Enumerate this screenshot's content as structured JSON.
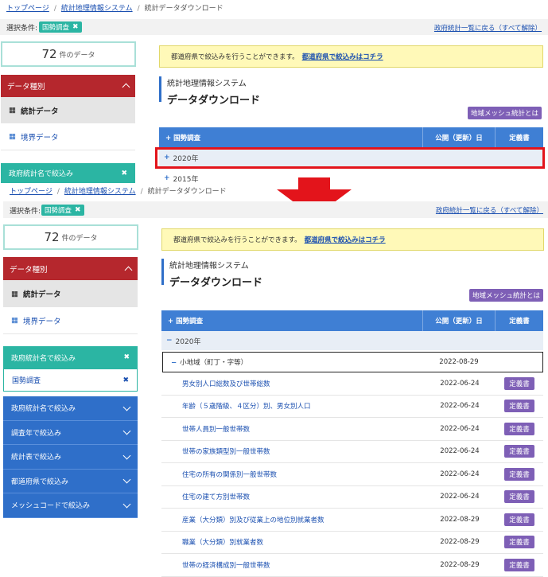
{
  "breadcrumb": {
    "top": "トップページ",
    "system": "統計地理情報システム",
    "current": "統計データダウンロード"
  },
  "condition": {
    "label": "選択条件:",
    "chip": "国勢調査",
    "chip_remove": "✖",
    "back_link": "政府統計一覧に戻る（すべて解除）"
  },
  "count": {
    "value": "72",
    "unit": "件のデータ"
  },
  "sidebar": {
    "data_type_title": "データ種別",
    "stat_data": "統計データ",
    "boundary_data": "境界データ",
    "filter_by_stat_name": "政府統計名で絞込み",
    "selected_filter": "国勢調査",
    "remove_icon": "✖",
    "accordion": [
      "政府統計名で絞込み",
      "調査年で絞込み",
      "統計表で絞込み",
      "都道府県で絞込み",
      "メッシュコードで絞込み"
    ]
  },
  "notice": {
    "text": "都道府県で絞込みを行うことができます。",
    "link": "都道府県で絞込みはコチラ"
  },
  "title": {
    "system": "統計地理情報システム",
    "page": "データダウンロード"
  },
  "mesh_button": "地域メッシュ統計とは",
  "table": {
    "headers": {
      "name": "国勢調査",
      "date": "公開（更新）日",
      "definition": "定義書"
    },
    "year_2020": "2020年",
    "year_2015": "2015年",
    "subgroup": {
      "label": "小地域（町丁・字等）",
      "date": "2022-08-29"
    },
    "definition_button": "定義書",
    "rows": [
      {
        "name": "男女別人口総数及び世帯総数",
        "date": "2022-06-24"
      },
      {
        "name": "年齢（５歳階級、４区分）別、男女別人口",
        "date": "2022-06-24"
      },
      {
        "name": "世帯人員別一般世帯数",
        "date": "2022-06-24"
      },
      {
        "name": "世帯の家族類型別一般世帯数",
        "date": "2022-06-24"
      },
      {
        "name": "住宅の所有の関係別一般世帯数",
        "date": "2022-06-24"
      },
      {
        "name": "住宅の建て方別世帯数",
        "date": "2022-06-24"
      },
      {
        "name": "産業（大分類）別及び従業上の地位別就業者数",
        "date": "2022-08-29"
      },
      {
        "name": "職業（大分類）別就業者数",
        "date": "2022-08-29"
      },
      {
        "name": "世帯の経済構成別一般世帯数",
        "date": "2022-08-29"
      }
    ]
  },
  "colors": {
    "red_highlight": "#e3141b",
    "teal": "#2bb5a3",
    "blue": "#2f6fc9",
    "purple": "#7e5fb6",
    "red_header": "#b5272d"
  },
  "icons": {
    "building": "building-icon",
    "grid": "grid-icon",
    "arrow": "down-arrow-icon"
  }
}
